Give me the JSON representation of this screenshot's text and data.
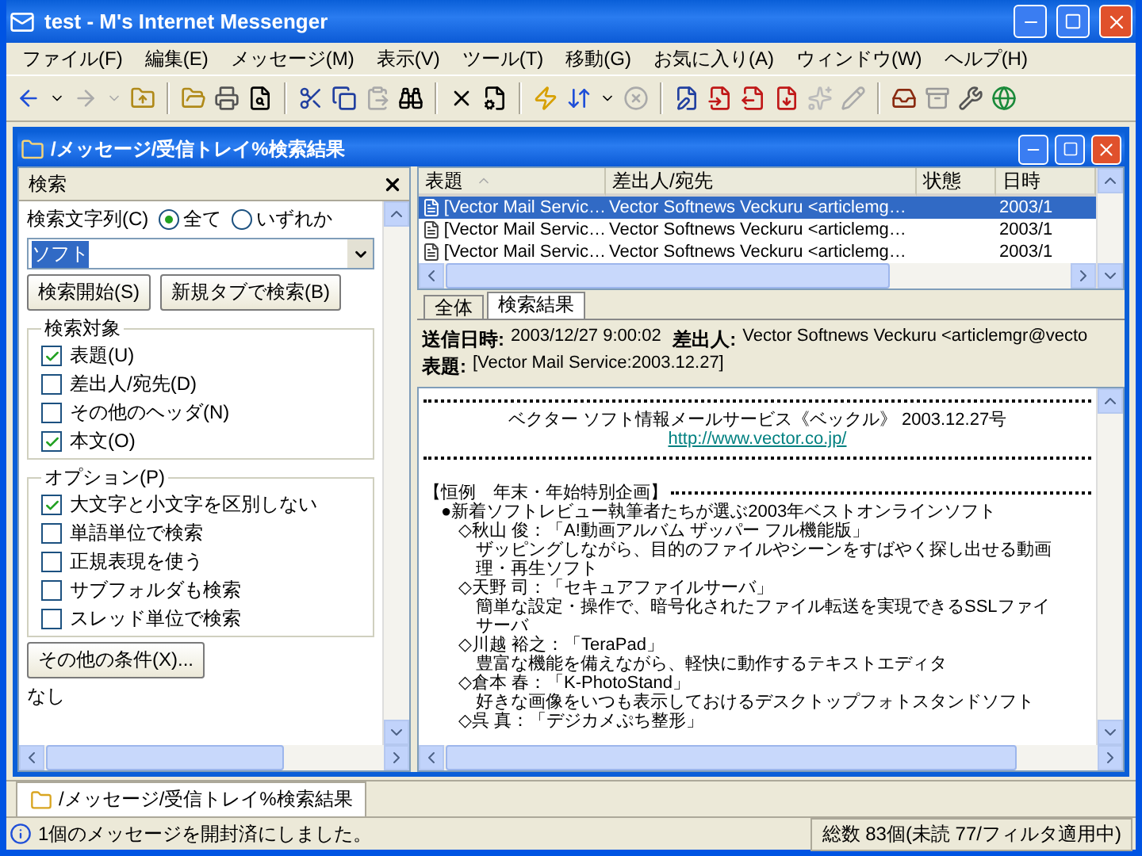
{
  "window": {
    "title": "test - M's Internet Messenger"
  },
  "menu": [
    {
      "label": "ファイル(F)"
    },
    {
      "label": "編集(E)"
    },
    {
      "label": "メッセージ(M)"
    },
    {
      "label": "表示(V)"
    },
    {
      "label": "ツール(T)"
    },
    {
      "label": "移動(G)"
    },
    {
      "label": "お気に入り(A)"
    },
    {
      "label": "ウィンドウ(W)"
    },
    {
      "label": "ヘルプ(H)"
    }
  ],
  "child_window": {
    "title": "/メッセージ/受信トレイ%検索結果"
  },
  "search_panel": {
    "title": "検索",
    "query_label": "検索文字列(C)",
    "match_options": [
      {
        "label": "全て",
        "selected": true
      },
      {
        "label": "いずれか",
        "selected": false
      }
    ],
    "query": "ソフト",
    "buttons": [
      "検索開始(S)",
      "新規タブで検索(B)"
    ],
    "targets": {
      "title": "検索対象",
      "items": [
        {
          "label": "表題(U)",
          "checked": true
        },
        {
          "label": "差出人/宛先(D)",
          "checked": false
        },
        {
          "label": "その他のヘッダ(N)",
          "checked": false
        },
        {
          "label": "本文(O)",
          "checked": true
        }
      ]
    },
    "options": {
      "title": "オプション(P)",
      "items": [
        {
          "label": "大文字と小文字を区別しない",
          "checked": true
        },
        {
          "label": "単語単位で検索",
          "checked": false
        },
        {
          "label": "正規表現を使う",
          "checked": false
        },
        {
          "label": "サブフォルダも検索",
          "checked": false
        },
        {
          "label": "スレッド単位で検索",
          "checked": false
        }
      ]
    },
    "more_button": "その他の条件(X)...",
    "conditions": "なし"
  },
  "message_list": {
    "columns": [
      "表題",
      "差出人/宛先",
      "状態",
      "日時"
    ],
    "rows": [
      {
        "subject": "[Vector Mail Servic…",
        "from": "Vector Softnews Veckuru <articlemg…",
        "date": "2003/1",
        "selected": true
      },
      {
        "subject": "[Vector Mail Servic…",
        "from": "Vector Softnews Veckuru <articlemg…",
        "date": "2003/1",
        "selected": false
      },
      {
        "subject": "[Vector Mail Servic…",
        "from": "Vector Softnews Veckuru <articlemg…",
        "date": "2003/1",
        "selected": false
      }
    ]
  },
  "view_tabs": [
    {
      "label": "全体",
      "selected": false
    },
    {
      "label": "検索結果",
      "selected": true
    }
  ],
  "message_header": {
    "date_label": "送信日時:",
    "date": "2003/12/27 9:00:02",
    "from_label": "差出人:",
    "from": "Vector Softnews Veckuru <articlemgr@vecto",
    "subject_label": "表題:",
    "subject": "[Vector Mail Service:2003.12.27]"
  },
  "message_body": {
    "banner": "ベクター ソフト情報メールサービス《ベックル》 2003.12.27号",
    "link": "http://www.vector.co.jp/",
    "sections": [
      {
        "heading": "【恒例　年末・年始特別企画】",
        "items": [
          {
            "text": "●新着ソフトレビュー執筆者たちが選ぶ2003年ベストオンラインソフト",
            "children": [
              {
                "text": "◇秋山 俊：「A!動画アルバム ザッパー フル機能版」",
                "lines": [
                  "ザッピングしながら、目的のファイルやシーンをすばやく探し出せる動画",
                  "理・再生ソフト"
                ]
              },
              {
                "text": "◇天野 司：「セキュアファイルサーバ」",
                "lines": [
                  "簡単な設定・操作で、暗号化されたファイル転送を実現できるSSLファイ",
                  "サーバ"
                ]
              },
              {
                "text": "◇川越 裕之：「TeraPad」",
                "lines": [
                  "豊富な機能を備えながら、軽快に動作するテキストエディタ"
                ]
              },
              {
                "text": "◇倉本 春：「K-PhotoStand」",
                "lines": [
                  "好きな画像をいつも表示しておけるデスクトップフォトスタンドソフト"
                ]
              },
              {
                "text": "◇呉 真：「デジカメぷち整形」"
              }
            ]
          }
        ]
      }
    ]
  },
  "window_tabs": [
    {
      "label": "/メッセージ/受信トレイ%検索結果",
      "selected": true
    }
  ],
  "status_bar": {
    "message": "1個のメッセージを開封済にしました。",
    "summary": "総数 83個(未読 77/フィルタ適用中)"
  }
}
